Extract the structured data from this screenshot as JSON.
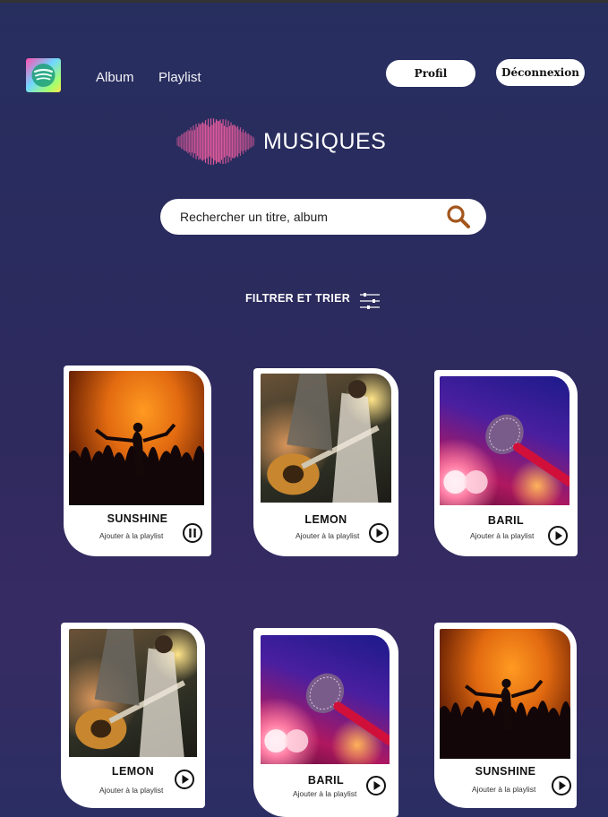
{
  "nav": {
    "album_label": "Album",
    "playlist_label": "Playlist",
    "profile_label": "Profil",
    "logout_label": "Déconnexion"
  },
  "header": {
    "title": "MUSIQUES"
  },
  "search": {
    "placeholder": "Rechercher un titre, album"
  },
  "filter": {
    "label": "FILTRER ET TRIER"
  },
  "colors": {
    "accent": "#a3551c",
    "card_bg": "#ffffff",
    "text_light": "#f4f4f8"
  },
  "cards": [
    {
      "title": "SUNSHINE",
      "action": "Ajouter à la playlist",
      "art": "concert-crowd",
      "state": "pause-icon"
    },
    {
      "title": "LEMON",
      "action": "Ajouter à la playlist",
      "art": "guitarist",
      "state": "play-icon"
    },
    {
      "title": "BARIL",
      "action": "Ajouter à la playlist",
      "art": "microphone",
      "state": "play-icon"
    },
    {
      "title": "LEMON",
      "action": "Ajouter à la playlist",
      "art": "guitarist",
      "state": "play-icon"
    },
    {
      "title": "BARIL",
      "action": "Ajouter à la playlist",
      "art": "microphone",
      "state": "play-icon"
    },
    {
      "title": "SUNSHINE",
      "action": "Ajouter à la playlist",
      "art": "concert-crowd",
      "state": "play-icon"
    }
  ]
}
